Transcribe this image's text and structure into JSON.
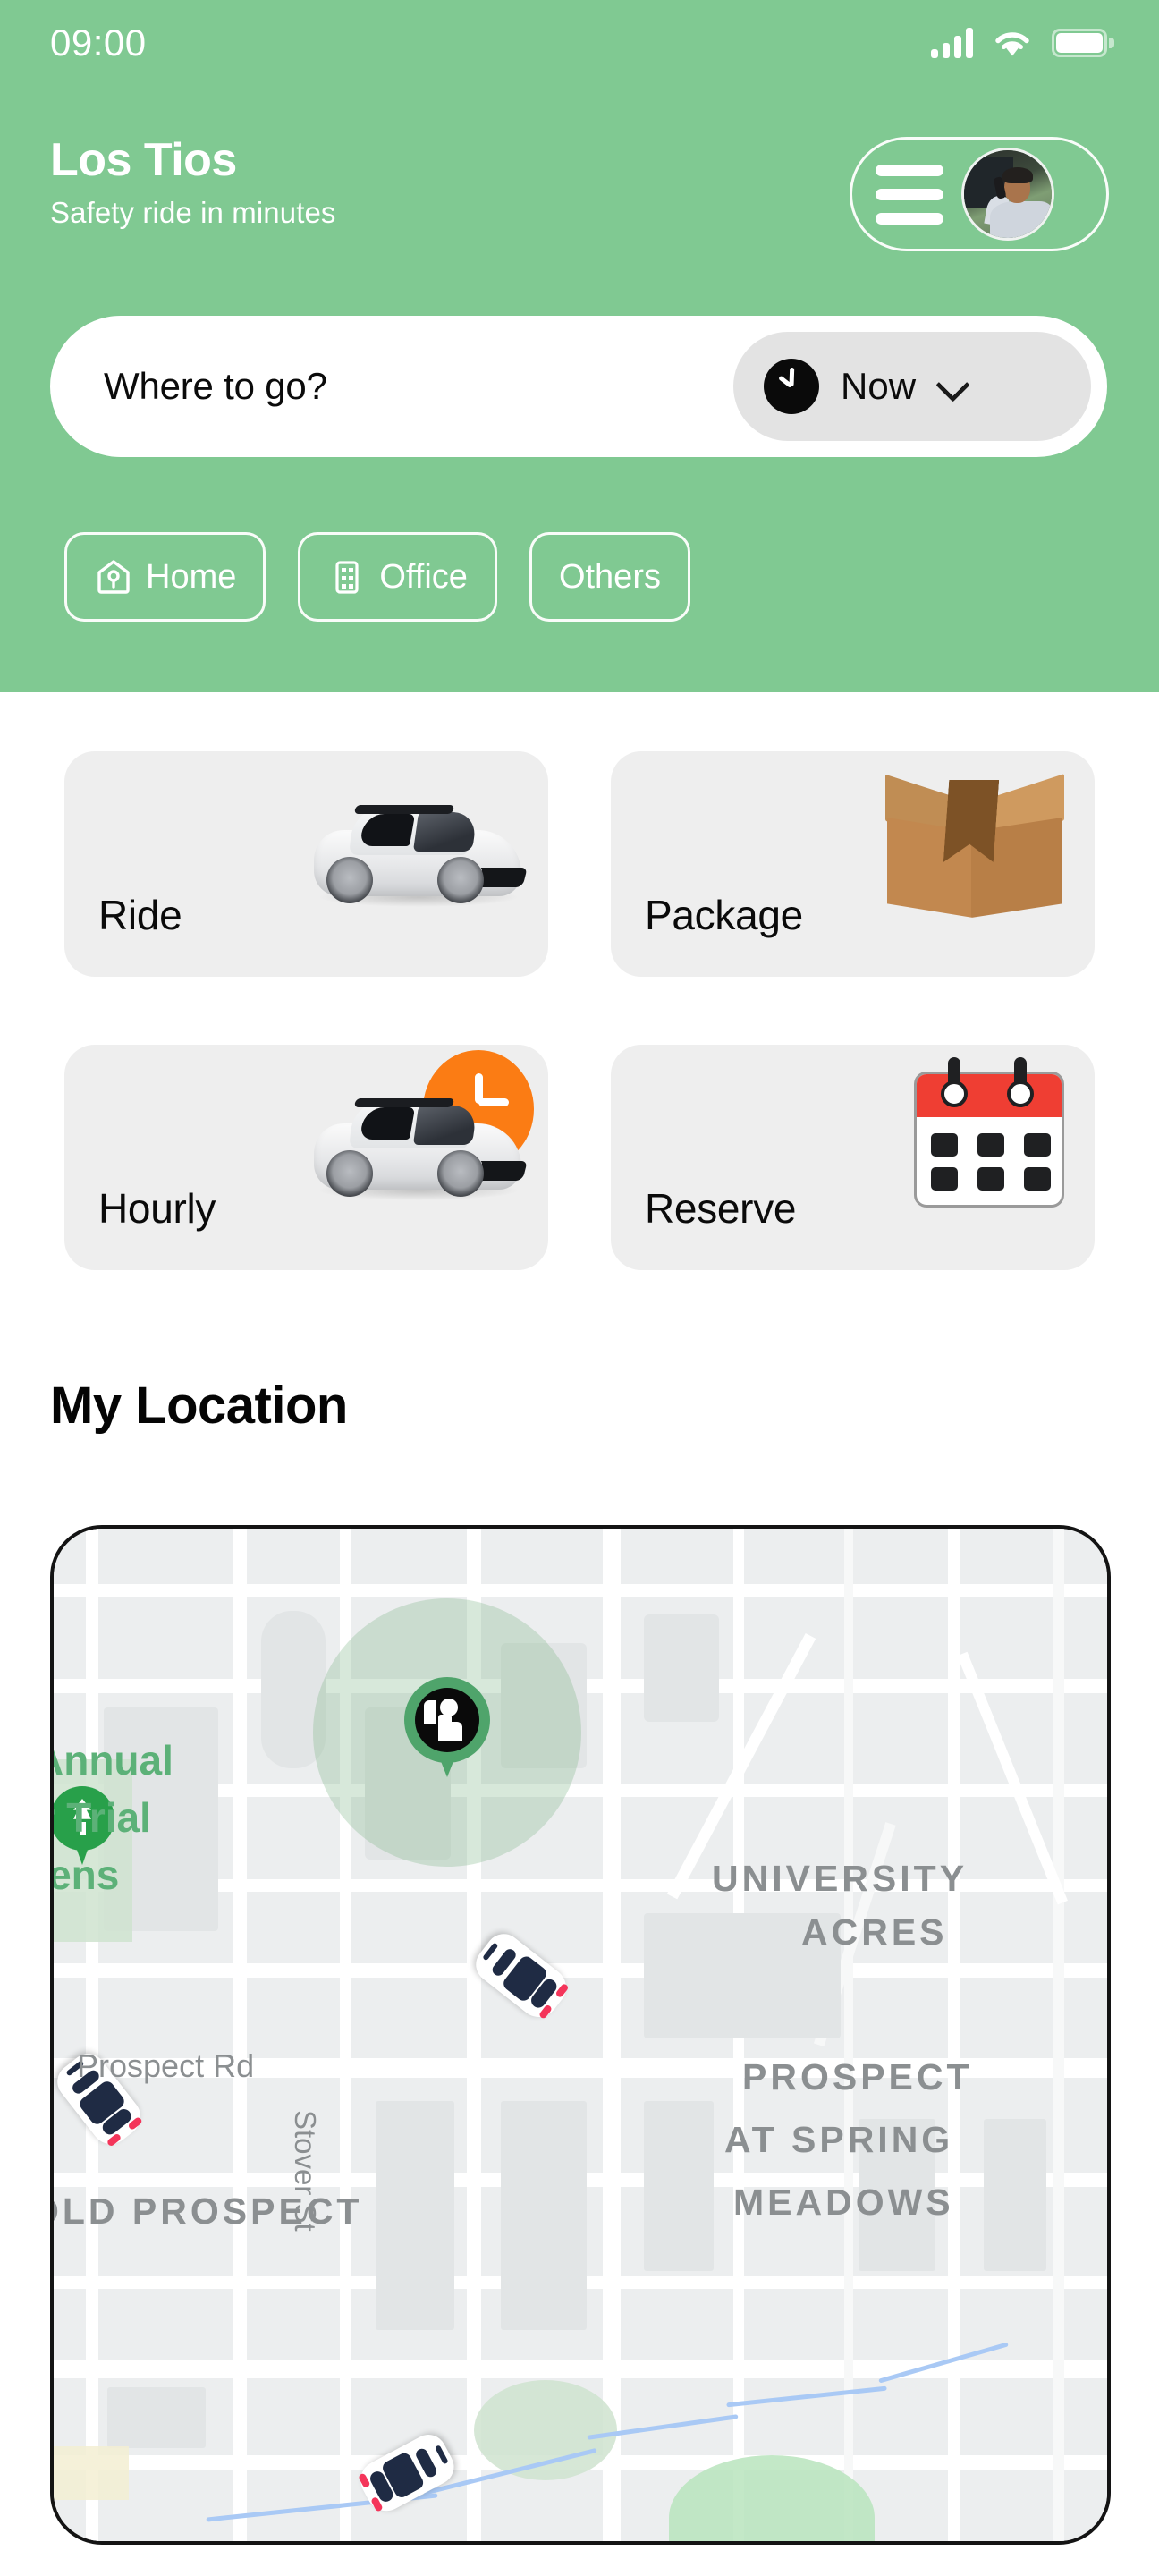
{
  "status_bar": {
    "time": "09:00",
    "signal_icon": "signal-bars-icon",
    "wifi_icon": "wifi-icon",
    "battery_icon": "battery-full-icon"
  },
  "header": {
    "brand_title": "Los Tios",
    "brand_subtitle": "Safety ride in minutes",
    "background_color": "#80c992",
    "menu_icon": "hamburger-menu-icon",
    "avatar": "user-avatar"
  },
  "search": {
    "placeholder": "Where to go?",
    "time_option": {
      "label": "Now",
      "clock_icon": "clock-icon",
      "chevron_icon": "chevron-down-icon"
    }
  },
  "shortcuts": [
    {
      "label": "Home",
      "icon": "home-icon"
    },
    {
      "label": "Office",
      "icon": "office-building-icon"
    },
    {
      "label": "Others",
      "icon": "none"
    }
  ],
  "services": [
    {
      "label": "Ride",
      "art": "white-car-3d"
    },
    {
      "label": "Package",
      "art": "cardboard-box"
    },
    {
      "label": "Hourly",
      "art": "white-car-3d-with-clock-badge"
    },
    {
      "label": "Reserve",
      "art": "calendar"
    }
  ],
  "location_section": {
    "title": "My Location"
  },
  "map": {
    "user_marker_icon": "person-hailing-pin",
    "park_marker_icon": "park-tree-pin",
    "area_labels": [
      "UNIVERSITY",
      "ACRES",
      "PROSPECT",
      "AT SPRING",
      "MEADOWS",
      "OLD PROSPECT"
    ],
    "green_labels": [
      "Annual",
      "er Trial",
      "dens"
    ],
    "street_labels": [
      "Prospect Rd",
      "Stover St"
    ],
    "vehicles": [
      "car-top-down-1",
      "car-top-down-2",
      "car-top-down-3"
    ]
  },
  "colors": {
    "brand_green": "#80c992",
    "card_gray": "#eeeeee",
    "accent_orange": "#fb7c14",
    "accent_red": "#ef3e33",
    "pin_green": "#4fa46b"
  }
}
